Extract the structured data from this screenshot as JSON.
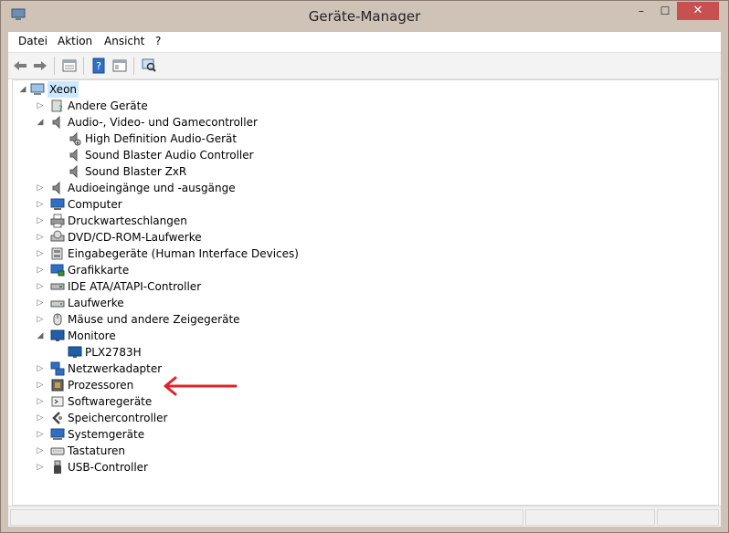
{
  "window": {
    "title": "Geräte-Manager",
    "close_glyph": "✕",
    "minimize_glyph": "–",
    "maximize_glyph": "☐"
  },
  "menu": [
    "Datei",
    "Aktion",
    "Ansicht",
    "?"
  ],
  "toolbar": [
    "back-icon",
    "forward-icon",
    "properties-icon",
    "help-icon",
    "view-icon",
    "scan-hardware-icon"
  ],
  "tree": {
    "root": "Xeon",
    "nodes": [
      {
        "label": "Andere Geräte",
        "icon": "unknown-device-icon",
        "state": "collapsed"
      },
      {
        "label": "Audio-, Video- und Gamecontroller",
        "icon": "speaker-icon",
        "state": "expanded",
        "children": [
          "High Definition Audio-Gerät",
          "Sound Blaster Audio Controller",
          "Sound Blaster ZxR"
        ]
      },
      {
        "label": "Audioeingänge und -ausgänge",
        "icon": "speaker-icon",
        "state": "collapsed"
      },
      {
        "label": "Computer",
        "icon": "computer-icon",
        "state": "collapsed"
      },
      {
        "label": "Druckwarteschlangen",
        "icon": "printer-icon",
        "state": "collapsed"
      },
      {
        "label": "DVD/CD-ROM-Laufwerke",
        "icon": "disc-drive-icon",
        "state": "collapsed"
      },
      {
        "label": "Eingabegeräte (Human Interface Devices)",
        "icon": "hid-icon",
        "state": "collapsed"
      },
      {
        "label": "Grafikkarte",
        "icon": "display-adapter-icon",
        "state": "collapsed"
      },
      {
        "label": "IDE ATA/ATAPI-Controller",
        "icon": "ide-controller-icon",
        "state": "collapsed"
      },
      {
        "label": "Laufwerke",
        "icon": "disk-drive-icon",
        "state": "collapsed"
      },
      {
        "label": "Mäuse und andere Zeigegeräte",
        "icon": "mouse-icon",
        "state": "collapsed"
      },
      {
        "label": "Monitore",
        "icon": "monitor-icon",
        "state": "expanded",
        "children": [
          "PLX2783H"
        ]
      },
      {
        "label": "Netzwerkadapter",
        "icon": "network-icon",
        "state": "collapsed"
      },
      {
        "label": "Prozessoren",
        "icon": "processor-icon",
        "state": "collapsed"
      },
      {
        "label": "Softwaregeräte",
        "icon": "software-device-icon",
        "state": "collapsed"
      },
      {
        "label": "Speichercontroller",
        "icon": "storage-controller-icon",
        "state": "collapsed"
      },
      {
        "label": "Systemgeräte",
        "icon": "system-device-icon",
        "state": "collapsed"
      },
      {
        "label": "Tastaturen",
        "icon": "keyboard-icon",
        "state": "collapsed"
      },
      {
        "label": "USB-Controller",
        "icon": "usb-icon",
        "state": "collapsed"
      }
    ]
  },
  "colors": {
    "title_bg": "#cfc3b8",
    "close_bg": "#c75050",
    "selection": "#cce8ff",
    "annotation_arrow": "#e0242b"
  }
}
